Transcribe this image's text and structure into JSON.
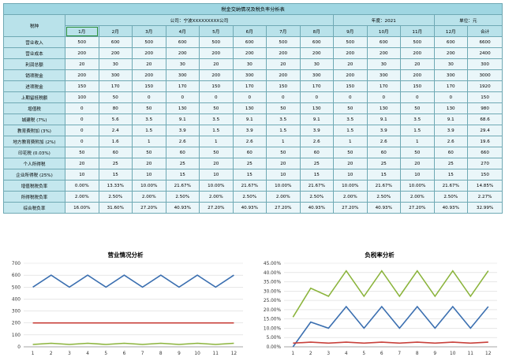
{
  "sheet": {
    "title": "税金交纳情况及税负率分析表",
    "company_label": "公司：宁波XXXXXXXXX公司",
    "year_label": "年度：2021",
    "unit_label": "单位：元",
    "tax_header": "税种",
    "months": [
      "1月",
      "2月",
      "3月",
      "4月",
      "5月",
      "6月",
      "7月",
      "8月",
      "9月",
      "10月",
      "11月",
      "12月"
    ],
    "total_header": "合计",
    "rows": [
      {
        "label": "营业收入",
        "values": [
          "500",
          "600",
          "500",
          "600",
          "500",
          "600",
          "500",
          "600",
          "500",
          "600",
          "500",
          "600"
        ],
        "total": "6600"
      },
      {
        "label": "营业成本",
        "values": [
          "200",
          "200",
          "200",
          "200",
          "200",
          "200",
          "200",
          "200",
          "200",
          "200",
          "200",
          "200"
        ],
        "total": "2400"
      },
      {
        "label": "利润总额",
        "values": [
          "20",
          "30",
          "20",
          "30",
          "20",
          "30",
          "20",
          "30",
          "20",
          "30",
          "20",
          "30"
        ],
        "total": "300"
      },
      {
        "label": "销项税金",
        "values": [
          "200",
          "300",
          "200",
          "300",
          "200",
          "300",
          "200",
          "300",
          "200",
          "300",
          "200",
          "300"
        ],
        "total": "3000"
      },
      {
        "label": "进项税金",
        "values": [
          "150",
          "170",
          "150",
          "170",
          "150",
          "170",
          "150",
          "170",
          "150",
          "170",
          "150",
          "170"
        ],
        "total": "1920"
      },
      {
        "label": "上期留抵税额",
        "values": [
          "100",
          "50",
          "0",
          "0",
          "0",
          "0",
          "0",
          "0",
          "0",
          "0",
          "0",
          "0"
        ],
        "total": "150"
      },
      {
        "label": "增值税",
        "values": [
          "0",
          "80",
          "50",
          "130",
          "50",
          "130",
          "50",
          "130",
          "50",
          "130",
          "50",
          "130"
        ],
        "total": "980"
      },
      {
        "label": "城建税 (7%)",
        "values": [
          "0",
          "5.6",
          "3.5",
          "9.1",
          "3.5",
          "9.1",
          "3.5",
          "9.1",
          "3.5",
          "9.1",
          "3.5",
          "9.1"
        ],
        "total": "68.6"
      },
      {
        "label": "教育费附加 (3%)",
        "values": [
          "0",
          "2.4",
          "1.5",
          "3.9",
          "1.5",
          "3.9",
          "1.5",
          "3.9",
          "1.5",
          "3.9",
          "1.5",
          "3.9"
        ],
        "total": "29.4"
      },
      {
        "label": "地方教育费附加 (2%)",
        "values": [
          "0",
          "1.6",
          "1",
          "2.6",
          "1",
          "2.6",
          "1",
          "2.6",
          "1",
          "2.6",
          "1",
          "2.6"
        ],
        "total": "19.6"
      },
      {
        "label": "印花税 (0.03%)",
        "values": [
          "50",
          "60",
          "50",
          "60",
          "50",
          "60",
          "50",
          "60",
          "50",
          "60",
          "50",
          "60"
        ],
        "total": "660"
      },
      {
        "label": "个人所得税",
        "values": [
          "20",
          "25",
          "20",
          "25",
          "20",
          "25",
          "20",
          "25",
          "20",
          "25",
          "20",
          "25"
        ],
        "total": "270"
      },
      {
        "label": "企业所得税 (25%)",
        "values": [
          "10",
          "15",
          "10",
          "15",
          "10",
          "15",
          "10",
          "15",
          "10",
          "15",
          "10",
          "15"
        ],
        "total": "150"
      },
      {
        "label": "增值税税负率",
        "values": [
          "0.00%",
          "13.33%",
          "10.00%",
          "21.67%",
          "10.00%",
          "21.67%",
          "10.00%",
          "21.67%",
          "10.00%",
          "21.67%",
          "10.00%",
          "21.67%"
        ],
        "total": "14.85%"
      },
      {
        "label": "所得税税负率",
        "values": [
          "2.00%",
          "2.50%",
          "2.00%",
          "2.50%",
          "2.00%",
          "2.50%",
          "2.00%",
          "2.50%",
          "2.00%",
          "2.50%",
          "2.00%",
          "2.50%"
        ],
        "total": "2.27%"
      },
      {
        "label": "综合税负率",
        "values": [
          "16.00%",
          "31.60%",
          "27.20%",
          "40.93%",
          "27.20%",
          "40.93%",
          "27.20%",
          "40.93%",
          "27.20%",
          "40.93%",
          "27.20%",
          "40.93%"
        ],
        "total": "32.99%"
      }
    ]
  },
  "chart_data": [
    {
      "type": "line",
      "title": "营业情况分析",
      "x": [
        1,
        2,
        3,
        4,
        5,
        6,
        7,
        8,
        9,
        10,
        11,
        12
      ],
      "series": [
        {
          "values": [
            500,
            600,
            500,
            600,
            500,
            600,
            500,
            600,
            500,
            600,
            500,
            600
          ],
          "color": "#3b6fb0"
        },
        {
          "values": [
            200,
            200,
            200,
            200,
            200,
            200,
            200,
            200,
            200,
            200,
            200,
            200
          ],
          "color": "#c8403a"
        },
        {
          "values": [
            20,
            30,
            20,
            30,
            20,
            30,
            20,
            30,
            20,
            30,
            20,
            30
          ],
          "color": "#8bb43c"
        }
      ],
      "ylim": [
        0,
        700
      ],
      "yticks": [
        0,
        100,
        200,
        300,
        400,
        500,
        600,
        700
      ],
      "legend": "none",
      "grid": "horizontal"
    },
    {
      "type": "line",
      "title": "负税率分析",
      "x": [
        1,
        2,
        3,
        4,
        5,
        6,
        7,
        8,
        9,
        10,
        11,
        12
      ],
      "series": [
        {
          "values": [
            0.0,
            13.33,
            10.0,
            21.67,
            10.0,
            21.67,
            10.0,
            21.67,
            10.0,
            21.67,
            10.0,
            21.67
          ],
          "color": "#3b6fb0"
        },
        {
          "values": [
            2.0,
            2.5,
            2.0,
            2.5,
            2.0,
            2.5,
            2.0,
            2.5,
            2.0,
            2.5,
            2.0,
            2.5
          ],
          "color": "#c8403a"
        },
        {
          "values": [
            16.0,
            31.6,
            27.2,
            40.93,
            27.2,
            40.93,
            27.2,
            40.93,
            27.2,
            40.93,
            27.2,
            40.93
          ],
          "color": "#8bb43c"
        }
      ],
      "ylim": [
        0,
        45
      ],
      "yticks": [
        0,
        5,
        10,
        15,
        20,
        25,
        30,
        35,
        40,
        45
      ],
      "ytick_format": "percent2",
      "legend": "none",
      "grid": "horizontal"
    }
  ]
}
